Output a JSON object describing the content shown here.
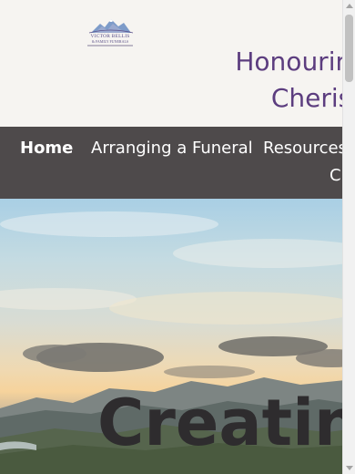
{
  "logo": {
    "name": "VICTOR BELLIS",
    "subtitle": "& FAMILY FUNERALS",
    "icon": "mountain-logo-icon"
  },
  "header": {
    "tagline_line1": "Honouring",
    "tagline_line2": "Cherish",
    "tagline_color": "#5c3d7f"
  },
  "nav": {
    "background": "#4e4a4b",
    "items": [
      {
        "label": "Home",
        "active": true
      },
      {
        "label": "Arranging a Funeral",
        "active": false
      },
      {
        "label": "Resources",
        "active": false
      },
      {
        "label": "C",
        "active": false
      }
    ]
  },
  "hero": {
    "title": "Creating"
  },
  "scrollbar": {
    "up_icon": "scroll-up-arrow-icon",
    "down_icon": "scroll-down-arrow-icon"
  }
}
